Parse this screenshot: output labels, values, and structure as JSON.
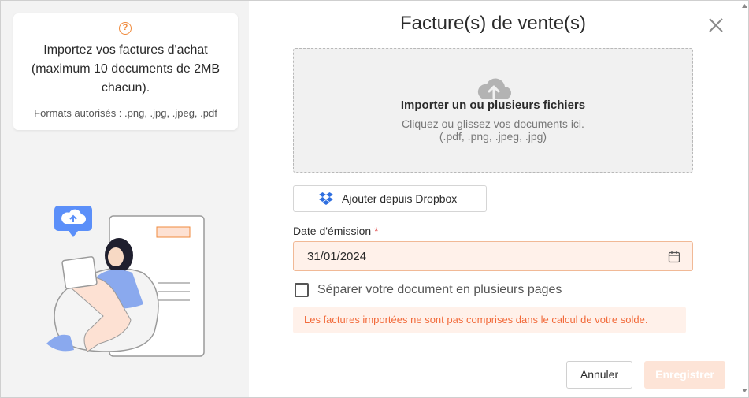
{
  "sidebar": {
    "help_icon": "question-circle-icon",
    "info_text": "Importez vos factures d'achat (maximum 10 documents de 2MB chacun).",
    "formats": "Formats autorisés : .png, .jpg, .jpeg, .pdf"
  },
  "modal": {
    "title": "Facture(s) de vente(s)",
    "close_icon": "close-icon"
  },
  "dropzone": {
    "icon": "cloud-upload-icon",
    "title": "Importer un ou plusieurs fichiers",
    "subtitle": "Cliquez ou glissez vos documents ici.",
    "formats": "(.pdf, .png, .jpeg, .jpg)"
  },
  "dropbox": {
    "icon": "dropbox-icon",
    "label": "Ajouter depuis Dropbox"
  },
  "date": {
    "label": "Date d'émission",
    "required_mark": "*",
    "value": "31/01/2024",
    "icon": "calendar-icon"
  },
  "split": {
    "label": "Séparer votre document en plusieurs pages",
    "checked": false
  },
  "alert": {
    "text": "Les factures importées ne sont pas comprises dans le calcul de votre solde."
  },
  "actions": {
    "cancel_label": "Annuler",
    "save_label": "Enregistrer"
  },
  "colors": {
    "accent": "#f08a3c",
    "alert_bg": "#fff1ea",
    "alert_text": "#f26a3a",
    "save_disabled_bg": "#fde4d7",
    "illustration_blue": "#5b8ff9"
  }
}
